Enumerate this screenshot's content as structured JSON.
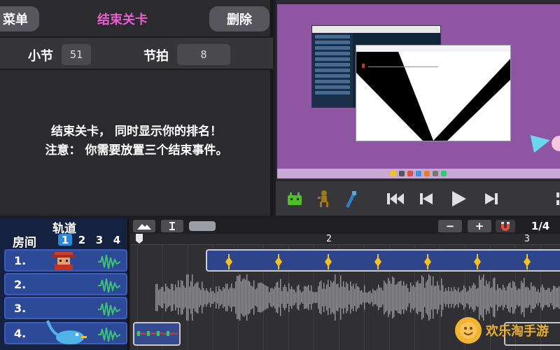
{
  "inspector": {
    "menu_label": "菜单",
    "title": "结束关卡",
    "delete_label": "删除",
    "bar_label": "小节",
    "bar_value": "51",
    "beat_label": "节拍",
    "beat_value": "8",
    "description_line1": "结束关卡， 同时显示你的排名！",
    "description_line2": "注意： 你需要放置三个结束事件。"
  },
  "transport": {
    "icons": [
      "bird-character-icon",
      "runner-character-icon",
      "tools-icon",
      "skip-to-start-icon",
      "previous-icon",
      "play-icon",
      "next-icon"
    ]
  },
  "tracks": {
    "title": "轨道",
    "rooms_label": "房间",
    "room_numbers": [
      "1",
      "2",
      "3",
      "4"
    ],
    "active_room": "1",
    "rows": [
      {
        "label": "1."
      },
      {
        "label": "2."
      },
      {
        "label": "3."
      },
      {
        "label": "4."
      }
    ]
  },
  "timeline": {
    "minus_label": "−",
    "plus_label": "+",
    "page_indicator": "1/4",
    "beat_numbers": [
      "2",
      "3"
    ],
    "cue_count": 7
  },
  "watermark": {
    "text": "欢乐淘手游"
  },
  "colors": {
    "title_pink": "#e85fcf",
    "track_blue": "#2c4a98",
    "cue_yellow": "#f6c21c",
    "preview_purple": "#8e55a3",
    "wave_green": "#3fbf7a"
  }
}
